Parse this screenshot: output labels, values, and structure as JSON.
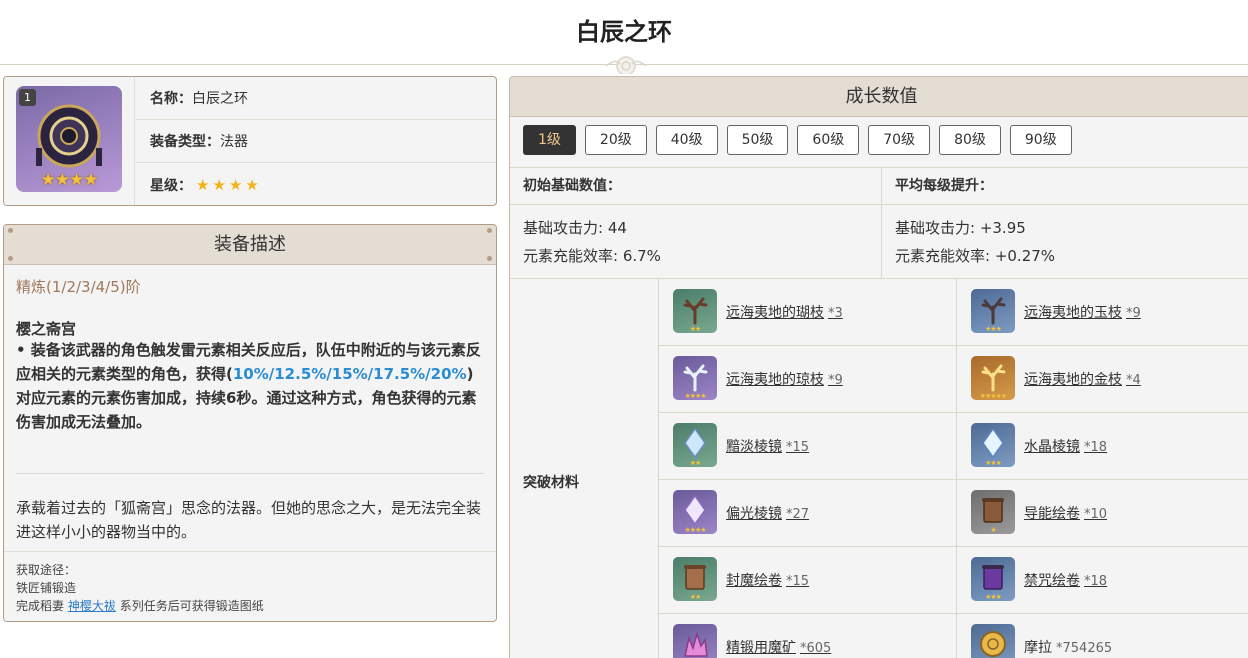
{
  "page": {
    "title": "白辰之环"
  },
  "weapon": {
    "badge": "1",
    "icon_stars": "★★★★",
    "name_label": "名称：",
    "name_value": "白辰之环",
    "type_label": "装备类型：",
    "type_value": "法器",
    "rarity_label": "星级：",
    "rarity_stars": "★★★★",
    "rarity_count": 4
  },
  "description": {
    "header": "装备描述",
    "refinement": "精炼(1/2/3/4/5)阶",
    "passive_name": "樱之斋宫",
    "passive_part1": "• 装备该武器的角色触发雷元素相关反应后，队伍中附近的与该元素反应相关的元素类型的角色，获得(",
    "passive_values": "10%/12.5%/15%/17.5%/20%",
    "passive_part2": ")对应元素的元素伤害加成，持续6秒。通过这种方式，角色获得的元素伤害加成无法叠加。",
    "lore": "承载着过去的「狐斋宫」思念的法器。但她的思念之大，是无法完全装进这样小小的器物当中的。",
    "source_title": "获取途径：",
    "source_line1": "铁匠铺锻造",
    "source_line2_prefix": "完成稻妻",
    "source_link": "神樱大祓",
    "source_line2_suffix": "系列任务后可获得锻造图纸"
  },
  "growth": {
    "header": "成长数值",
    "levels": [
      "1级",
      "20级",
      "40级",
      "50级",
      "60级",
      "70级",
      "80级",
      "90级"
    ],
    "active_level": "1级",
    "base_header": "初始基础数值：",
    "growth_header": "平均每级提升：",
    "base_stats": [
      "基础攻击力: 44",
      "元素充能效率: 6.7%"
    ],
    "growth_stats": [
      "基础攻击力: +3.95",
      "元素充能效率: +0.27%"
    ],
    "materials_label": "突破材料",
    "materials": [
      {
        "name": "远海夷地的瑚枝",
        "count": "*3",
        "icon": "coral-branch-icon",
        "stars": "★★"
      },
      {
        "name": "远海夷地的玉枝",
        "count": "*9",
        "icon": "jade-branch-icon",
        "stars": "★★★"
      },
      {
        "name": "远海夷地的琼枝",
        "count": "*9",
        "icon": "jeweled-branch-icon",
        "stars": "★★★★"
      },
      {
        "name": "远海夷地的金枝",
        "count": "*4",
        "icon": "golden-branch-icon",
        "stars": "★★★★★"
      },
      {
        "name": "黯淡棱镜",
        "count": "*15",
        "icon": "dull-prism-icon",
        "stars": "★★"
      },
      {
        "name": "水晶棱镜",
        "count": "*18",
        "icon": "crystal-prism-icon",
        "stars": "★★★"
      },
      {
        "name": "偏光棱镜",
        "count": "*27",
        "icon": "polarizing-prism-icon",
        "stars": "★★★★"
      },
      {
        "name": "导能绘卷",
        "count": "*10",
        "icon": "divining-scroll-icon",
        "stars": "★"
      },
      {
        "name": "封魔绘卷",
        "count": "*15",
        "icon": "sealed-scroll-icon",
        "stars": "★★"
      },
      {
        "name": "禁咒绘卷",
        "count": "*18",
        "icon": "forbidden-scroll-icon",
        "stars": "★★★"
      },
      {
        "name": "精锻用魔矿",
        "count": "*605",
        "icon": "enhancement-ore-icon",
        "stars": "★★★"
      },
      {
        "name": "摩拉",
        "count": "*754265",
        "icon": "mora-coin-icon",
        "stars": "★★★"
      }
    ]
  }
}
